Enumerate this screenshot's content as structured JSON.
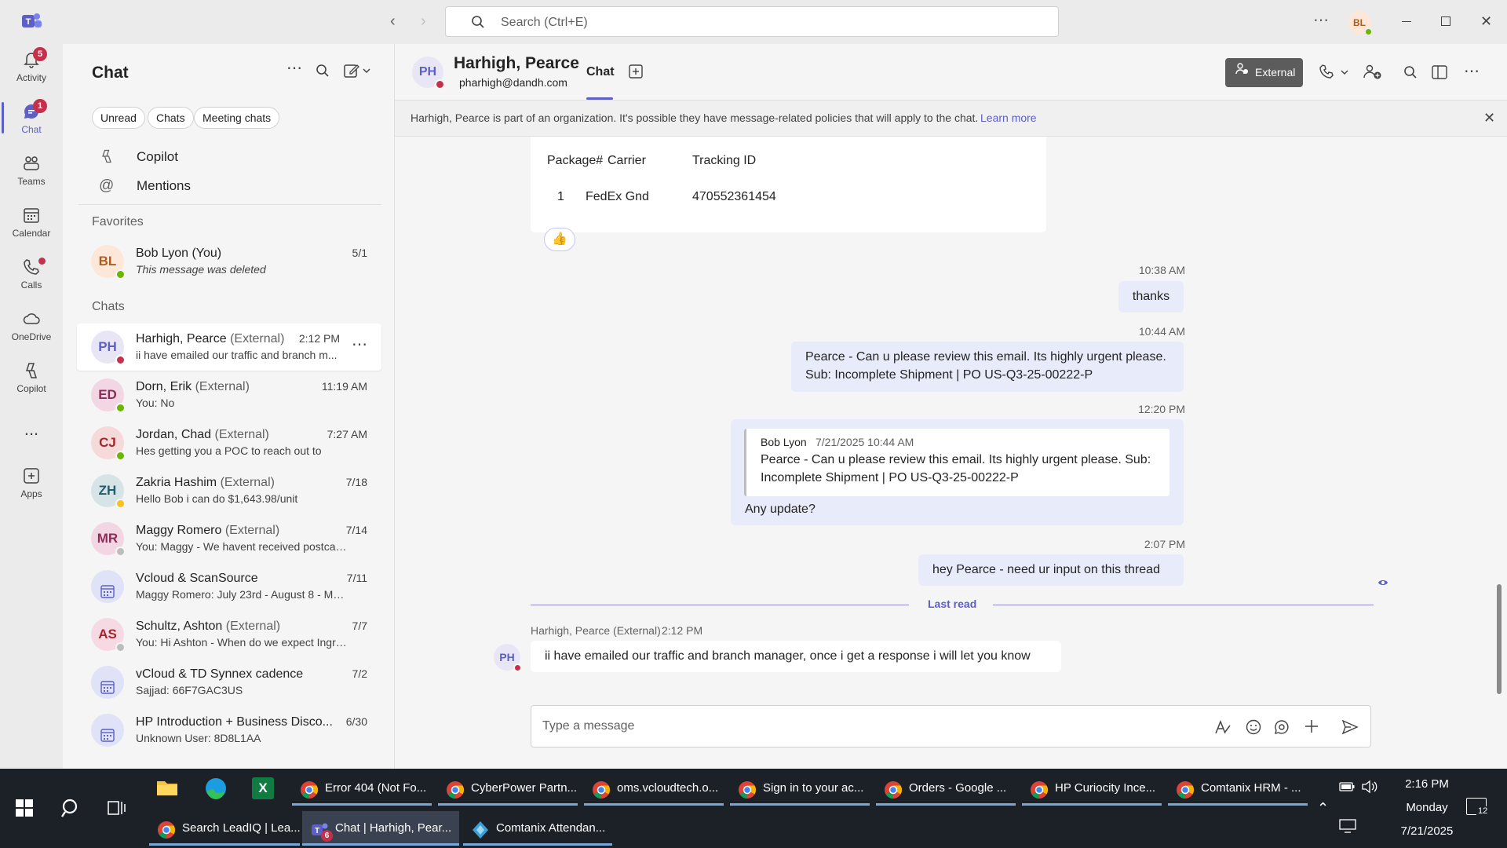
{
  "titlebar": {
    "search_placeholder": "Search (Ctrl+E)",
    "user_initials": "BL"
  },
  "rail": {
    "items": [
      {
        "label": "Activity",
        "badge": "5"
      },
      {
        "label": "Chat",
        "badge": "1"
      },
      {
        "label": "Teams"
      },
      {
        "label": "Calendar"
      },
      {
        "label": "Calls"
      },
      {
        "label": "OneDrive"
      },
      {
        "label": "Copilot"
      },
      {
        "label": "..."
      },
      {
        "label": "Apps"
      }
    ]
  },
  "chatlist": {
    "title": "Chat",
    "filters": [
      "Unread",
      "Chats",
      "Meeting chats"
    ],
    "nav": [
      "Copilot",
      "Mentions"
    ],
    "favorites_label": "Favorites",
    "chats_label": "Chats",
    "favorites": [
      {
        "initials": "BL",
        "name": "Bob Lyon (You)",
        "ext": "",
        "preview": "This message was deleted",
        "time": "5/1",
        "avatar_bg": "#fde7d9",
        "avatar_fg": "#b15c1f",
        "presence": "#6bb700"
      }
    ],
    "chats": [
      {
        "initials": "PH",
        "name": "Harhigh, Pearce",
        "ext": "(External)",
        "preview": "ii have emailed our traffic and branch m...",
        "time": "2:12 PM",
        "avatar_bg": "#e8e6f5",
        "avatar_fg": "#5b5fc7",
        "presence": "#c4314b"
      },
      {
        "initials": "ED",
        "name": "Dorn, Erik",
        "ext": "(External)",
        "preview": "You: No",
        "time": "11:19 AM",
        "avatar_bg": "#f3d6e3",
        "avatar_fg": "#8c2d58",
        "presence": "#6bb700"
      },
      {
        "initials": "CJ",
        "name": "Jordan, Chad",
        "ext": "(External)",
        "preview": "Hes getting you a POC to reach out to",
        "time": "7:27 AM",
        "avatar_bg": "#f6d9d9",
        "avatar_fg": "#a4262c",
        "presence": "#6bb700"
      },
      {
        "initials": "ZH",
        "name": "Zakria Hashim",
        "ext": "(External)",
        "preview": "Hello Bob i can do $1,643.98/unit",
        "time": "7/18",
        "avatar_bg": "#d6e4e8",
        "avatar_fg": "#1f5e6b",
        "presence": "#f8c21b"
      },
      {
        "initials": "MR",
        "name": "Maggy Romero",
        "ext": "(External)",
        "preview": "You: Maggy - We havent received postcard fo...",
        "time": "7/14",
        "avatar_bg": "#f3d6e3",
        "avatar_fg": "#8c2d58",
        "presence": "#bdbdbd"
      },
      {
        "initials": "",
        "name": "Vcloud & ScanSource",
        "ext": "",
        "preview": "Maggy Romero: July 23rd - August 8 - Maggy...",
        "time": "7/11",
        "avatar_bg": "#e0e2f7",
        "avatar_fg": "#5b5fc7",
        "presence": ""
      },
      {
        "initials": "AS",
        "name": "Schultz, Ashton",
        "ext": "(External)",
        "preview": "You: Hi Ashton -  When do we expect Ingram ...",
        "time": "7/7",
        "avatar_bg": "#f6d9e3",
        "avatar_fg": "#a4262c",
        "presence": "#bdbdbd"
      },
      {
        "initials": "",
        "name": "vCloud & TD Synnex cadence",
        "ext": "",
        "preview": "Sajjad: 66F7GAC3US",
        "time": "7/2",
        "avatar_bg": "#e0e2f7",
        "avatar_fg": "#5b5fc7",
        "presence": ""
      },
      {
        "initials": "",
        "name": "HP Introduction + Business Disco...",
        "ext": "",
        "preview": "Unknown User: 8D8L1AA",
        "time": "6/30",
        "avatar_bg": "#e0e2f7",
        "avatar_fg": "#5b5fc7",
        "presence": ""
      }
    ]
  },
  "header": {
    "initials": "PH",
    "name": "Harhigh, Pearce",
    "email": "pharhigh@dandh.com",
    "tab_chat": "Chat",
    "external_label": "External"
  },
  "banner": {
    "text": "Harhigh, Pearce is part of an organization. It's possible they have message-related policies that will apply to the chat.",
    "link": "Learn more"
  },
  "conversation": {
    "table": {
      "headers": [
        "Package#",
        "Carrier",
        "Tracking ID"
      ],
      "row": [
        "1",
        "FedEx Gnd",
        "470552361454"
      ]
    },
    "reaction": "👍",
    "msgs": [
      {
        "time": "10:38 AM",
        "text": "thanks"
      },
      {
        "time": "10:44 AM",
        "line1": "Pearce -  Can u please review this email. Its highly urgent please.",
        "line2": "Sub: Incomplete Shipment | PO US-Q3-25-00222-P"
      },
      {
        "time": "12:20 PM",
        "quote_author": "Bob Lyon",
        "quote_time": "7/21/2025 10:44 AM",
        "quote_line1": "Pearce - Can u please review this email. Its highly urgent please. Sub:",
        "quote_line2": "Incomplete Shipment | PO US-Q3-25-00222-P",
        "text": "Any update?"
      },
      {
        "time": "2:07 PM",
        "text": "hey Pearce -  need ur input on this thread"
      }
    ],
    "last_read": "Last read",
    "incoming": {
      "initials": "PH",
      "sender": "Harhigh, Pearce (External)",
      "time": "2:12 PM",
      "text": "ii have emailed our traffic and branch manager, once i get a response i will let you know"
    }
  },
  "composer": {
    "placeholder": "Type a message"
  },
  "taskbar": {
    "row1": [
      {
        "label": "Error 404 (Not Fo..."
      },
      {
        "label": "CyberPower Partn..."
      },
      {
        "label": "oms.vcloudtech.o..."
      },
      {
        "label": "Sign in to your ac..."
      },
      {
        "label": "Orders - Google ..."
      },
      {
        "label": "HP Curiocity Ince..."
      },
      {
        "label": "Comtanix HRM - ..."
      }
    ],
    "row2": [
      {
        "label": "Search LeadIQ | Lea..."
      },
      {
        "label": "Chat | Harhigh, Pear...",
        "badge": "6"
      },
      {
        "label": "Comtanix Attendan..."
      }
    ],
    "clock_time": "2:16 PM",
    "clock_day": "Monday",
    "clock_date": "7/21/2025",
    "notif_count": "12"
  }
}
